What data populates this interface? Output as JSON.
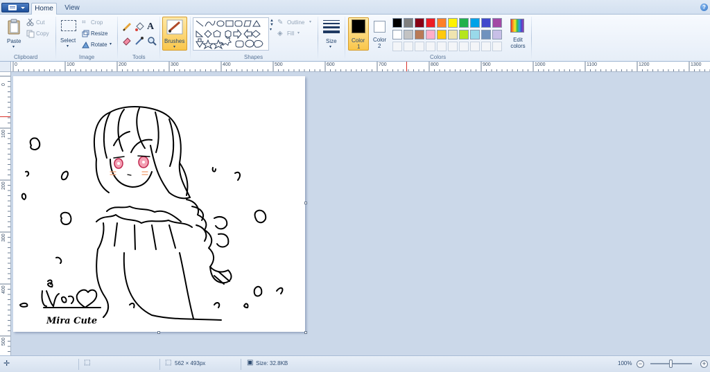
{
  "tabs": [
    {
      "label": "Home"
    },
    {
      "label": "View"
    }
  ],
  "help_glyph": "?",
  "clipboard": {
    "paste": "Paste",
    "cut": "Cut",
    "copy": "Copy",
    "group": "Clipboard"
  },
  "image": {
    "select": "Select",
    "crop": "Crop",
    "resize": "Resize",
    "rotate": "Rotate",
    "group": "Image"
  },
  "tools": {
    "group": "Tools",
    "text_glyph": "A"
  },
  "brushes": {
    "label": "Brushes"
  },
  "shapes": {
    "outline": "Outline",
    "fill": "Fill",
    "group": "Shapes"
  },
  "size": {
    "label": "Size"
  },
  "colors": {
    "color1": {
      "label": "Color",
      "index": "1",
      "value": "#000000"
    },
    "color2": {
      "label": "Color",
      "index": "2",
      "value": "#ffffff"
    },
    "edit": "Edit colors",
    "group": "Colors",
    "palette_row1": [
      "#000000",
      "#7f7f7f",
      "#880015",
      "#ed1c24",
      "#ff7f27",
      "#fff200",
      "#22b14c",
      "#00a2e8",
      "#3f48cc",
      "#a349a4"
    ],
    "palette_row2": [
      "#ffffff",
      "#c3c3c3",
      "#b97a57",
      "#ffaec9",
      "#ffc90e",
      "#efe4b0",
      "#b5e61d",
      "#99d9ea",
      "#7092be",
      "#c8bfe7"
    ]
  },
  "ruler": {
    "h_labels": [
      "0",
      "100",
      "200",
      "300",
      "400",
      "500",
      "600",
      "700",
      "800",
      "900",
      "1000",
      "1100",
      "1200",
      "1300"
    ],
    "v_labels": [
      "0",
      "100",
      "200",
      "300",
      "400",
      "500"
    ]
  },
  "drawing": {
    "signature": "Mira Cute"
  },
  "status": {
    "dimensions": "562 × 493px",
    "size": "Size: 32.8KB",
    "zoom": "100%",
    "zoom_out": "−",
    "zoom_in": "+"
  }
}
